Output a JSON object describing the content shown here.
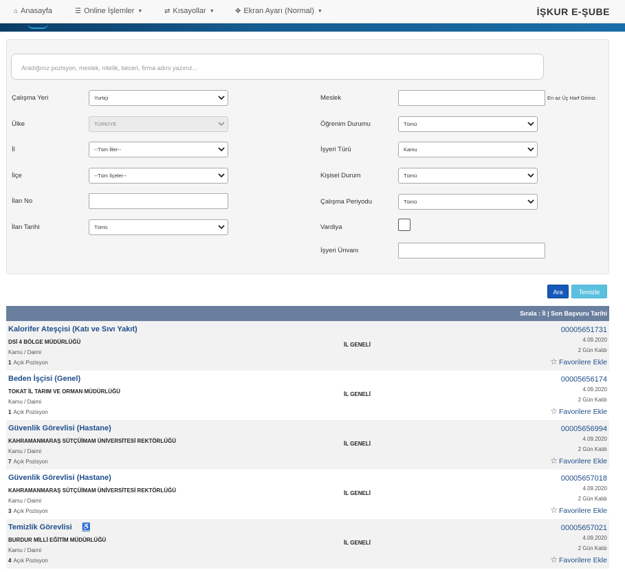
{
  "nav": {
    "home": "Anasayfa",
    "online": "Online İşlemler",
    "shortcuts": "Kısayollar",
    "screen": "Ekran Ayarı (Normal)",
    "brand": "İŞKUR E-ŞUBE"
  },
  "search": {
    "placeholder": "Aradığınız pozisyon, meslek, nitelik, beceri, firma adını yazınız..."
  },
  "filters": {
    "calisma_yeri": {
      "label": "Çalışma Yeri",
      "value": "Yurtiçi"
    },
    "ulke": {
      "label": "Ülke",
      "value": "TÜRKİYE"
    },
    "il": {
      "label": "İl",
      "value": "--Tüm İller--"
    },
    "ilce": {
      "label": "İlçe",
      "value": "--Tüm İlçeler--"
    },
    "ilan_no": {
      "label": "İlan No",
      "value": ""
    },
    "ilan_tarihi": {
      "label": "İlan Tarihi",
      "value": "Tümü"
    },
    "meslek": {
      "label": "Meslek",
      "value": "",
      "hint": "En az Üç Harf Giriniz."
    },
    "ogrenim": {
      "label": "Öğrenim Durumu",
      "value": "Tümü"
    },
    "isyeri_turu": {
      "label": "İşyeri Türü",
      "value": "Kamu"
    },
    "kisisel": {
      "label": "Kişisel Durum",
      "value": "Tümü"
    },
    "periyot": {
      "label": "Çalışma Periyodu",
      "value": "Tümü"
    },
    "vardiya": {
      "label": "Vardiya"
    },
    "unvan": {
      "label": "İşyeri Ünvanı",
      "value": ""
    }
  },
  "buttons": {
    "search": "Ara",
    "clear": "Temizle"
  },
  "list_header": "Sırala : İl | Son Başvuru Tarihi",
  "fav_label": "Favorilere Ekle",
  "pos_suffix": "Açık Pozisyon",
  "jobs": [
    {
      "title": "Kalorifer Ateşçisi (Katı ve Sıvı Yakıt)",
      "company": "DSİ 4 BÖLGE MÜDÜRLÜĞÜ",
      "type": "Kamu / Daimi",
      "positions": "1",
      "location": "İL GENELİ",
      "id": "00005651731",
      "date": "4.09.2020",
      "remaining": "2 Gün Kaldı"
    },
    {
      "title": "Beden İşçisi (Genel)",
      "company": "TOKAT İL TARIM VE ORMAN MÜDÜRLÜĞÜ",
      "type": "Kamu / Daimi",
      "positions": "1",
      "location": "İL GENELİ",
      "id": "00005656174",
      "date": "4.09.2020",
      "remaining": "2 Gün Kaldı"
    },
    {
      "title": "Güvenlik Görevlisi (Hastane)",
      "company": "KAHRAMANMARAŞ SÜTÇÜİMAM ÜNİVERSİTESİ REKTÖRLÜĞÜ",
      "type": "Kamu / Daimi",
      "positions": "7",
      "location": "İL GENELİ",
      "id": "00005656994",
      "date": "4.09.2020",
      "remaining": "2 Gün Kaldı"
    },
    {
      "title": "Güvenlik Görevlisi (Hastane)",
      "company": "KAHRAMANMARAŞ SÜTÇÜİMAM ÜNİVERSİTESİ REKTÖRLÜĞÜ",
      "type": "Kamu / Daimi",
      "positions": "3",
      "location": "İL GENELİ",
      "id": "00005657018",
      "date": "4.09.2020",
      "remaining": "2 Gün Kaldı"
    },
    {
      "title": "Temizlik Görevlisi",
      "company": "BURDUR MİLLİ EĞİTİM MÜDÜRLÜĞÜ",
      "type": "Kamu / Daimi",
      "positions": "4",
      "location": "İL GENELİ",
      "id": "00005657021",
      "date": "4.09.2020",
      "remaining": "2 Gün Kaldı"
    }
  ]
}
